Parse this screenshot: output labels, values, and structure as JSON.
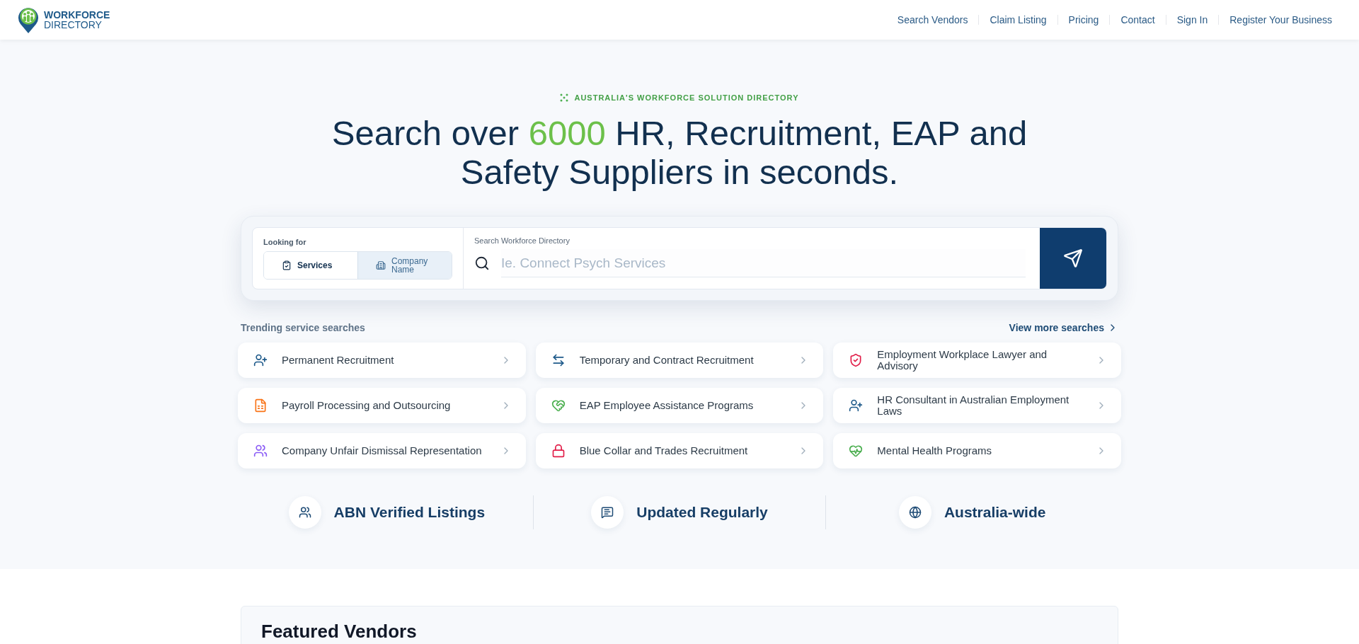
{
  "logo": {
    "line1": "WORKFORCE",
    "line2": "DIRECTORY"
  },
  "nav": [
    "Search Vendors",
    "Claim Listing",
    "Pricing",
    "Contact",
    "Sign In",
    "Register Your Business"
  ],
  "badge": "AUSTRALIA'S WORKFORCE SOLUTION DIRECTORY",
  "heading": {
    "before": "Search over ",
    "highlight": "6000",
    "after": " HR, Recruitment, EAP and Safety Suppliers in seconds."
  },
  "search": {
    "looking_for": "Looking for",
    "options": [
      {
        "label": "Services",
        "selected": true
      },
      {
        "label": "Company Name",
        "selected": false
      }
    ],
    "field_label": "Search Workforce Directory",
    "placeholder": "Ie. Connect Psych Services"
  },
  "trending": {
    "title": "Trending service searches",
    "more": "View more searches",
    "items": [
      {
        "label": "Permanent Recruitment",
        "color": "#1e5a8a"
      },
      {
        "label": "Temporary and Contract Recruitment",
        "color": "#1e5a8a"
      },
      {
        "label": "Employment Workplace Lawyer and Advisory",
        "color": "#e11d48"
      },
      {
        "label": "Payroll Processing and Outsourcing",
        "color": "#f97316"
      },
      {
        "label": "EAP Employee Assistance Programs",
        "color": "#4caf50"
      },
      {
        "label": "HR Consultant in Australian Employment Laws",
        "color": "#1e5a8a"
      },
      {
        "label": "Company Unfair Dismissal Representation",
        "color": "#8b5cf6"
      },
      {
        "label": "Blue Collar and Trades Recruitment",
        "color": "#e11d48"
      },
      {
        "label": "Mental Health Programs",
        "color": "#4caf50"
      }
    ]
  },
  "features": [
    "ABN Verified Listings",
    "Updated Regularly",
    "Australia-wide"
  ],
  "featured": {
    "title": "Featured Vendors"
  }
}
